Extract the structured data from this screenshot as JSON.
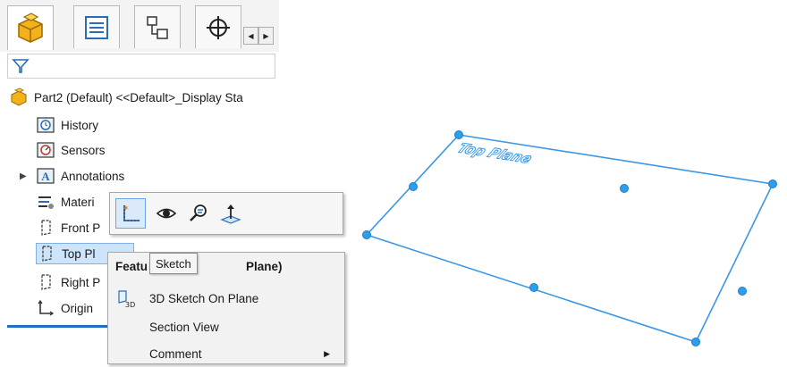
{
  "tree": {
    "root": "Part2 (Default) <<Default>_Display Sta",
    "items": [
      {
        "label": "History",
        "icon": "history-icon"
      },
      {
        "label": "Sensors",
        "icon": "sensors-icon"
      },
      {
        "label": "Annotations",
        "icon": "annotations-icon"
      },
      {
        "label": "Materi",
        "icon": "material-icon"
      },
      {
        "label": "Front P",
        "icon": "plane-icon"
      },
      {
        "label": "Top Pl",
        "icon": "plane-icon"
      },
      {
        "label": "Right P",
        "icon": "plane-icon"
      },
      {
        "label": "Origin",
        "icon": "origin-icon"
      }
    ]
  },
  "context_menu": {
    "header": "Featu",
    "header_tail": "Plane)",
    "items": [
      {
        "label": "3D Sketch On Plane",
        "icon": "3d-sketch-icon"
      },
      {
        "label": "Section View"
      },
      {
        "label": "Comment",
        "has_submenu": true
      }
    ]
  },
  "tooltip": "Sketch",
  "viewport": {
    "plane_label": "Top Plane"
  },
  "colors": {
    "accent": "#1f6fc5",
    "plane": "#3b97e6",
    "selection": "#cde4fb"
  }
}
